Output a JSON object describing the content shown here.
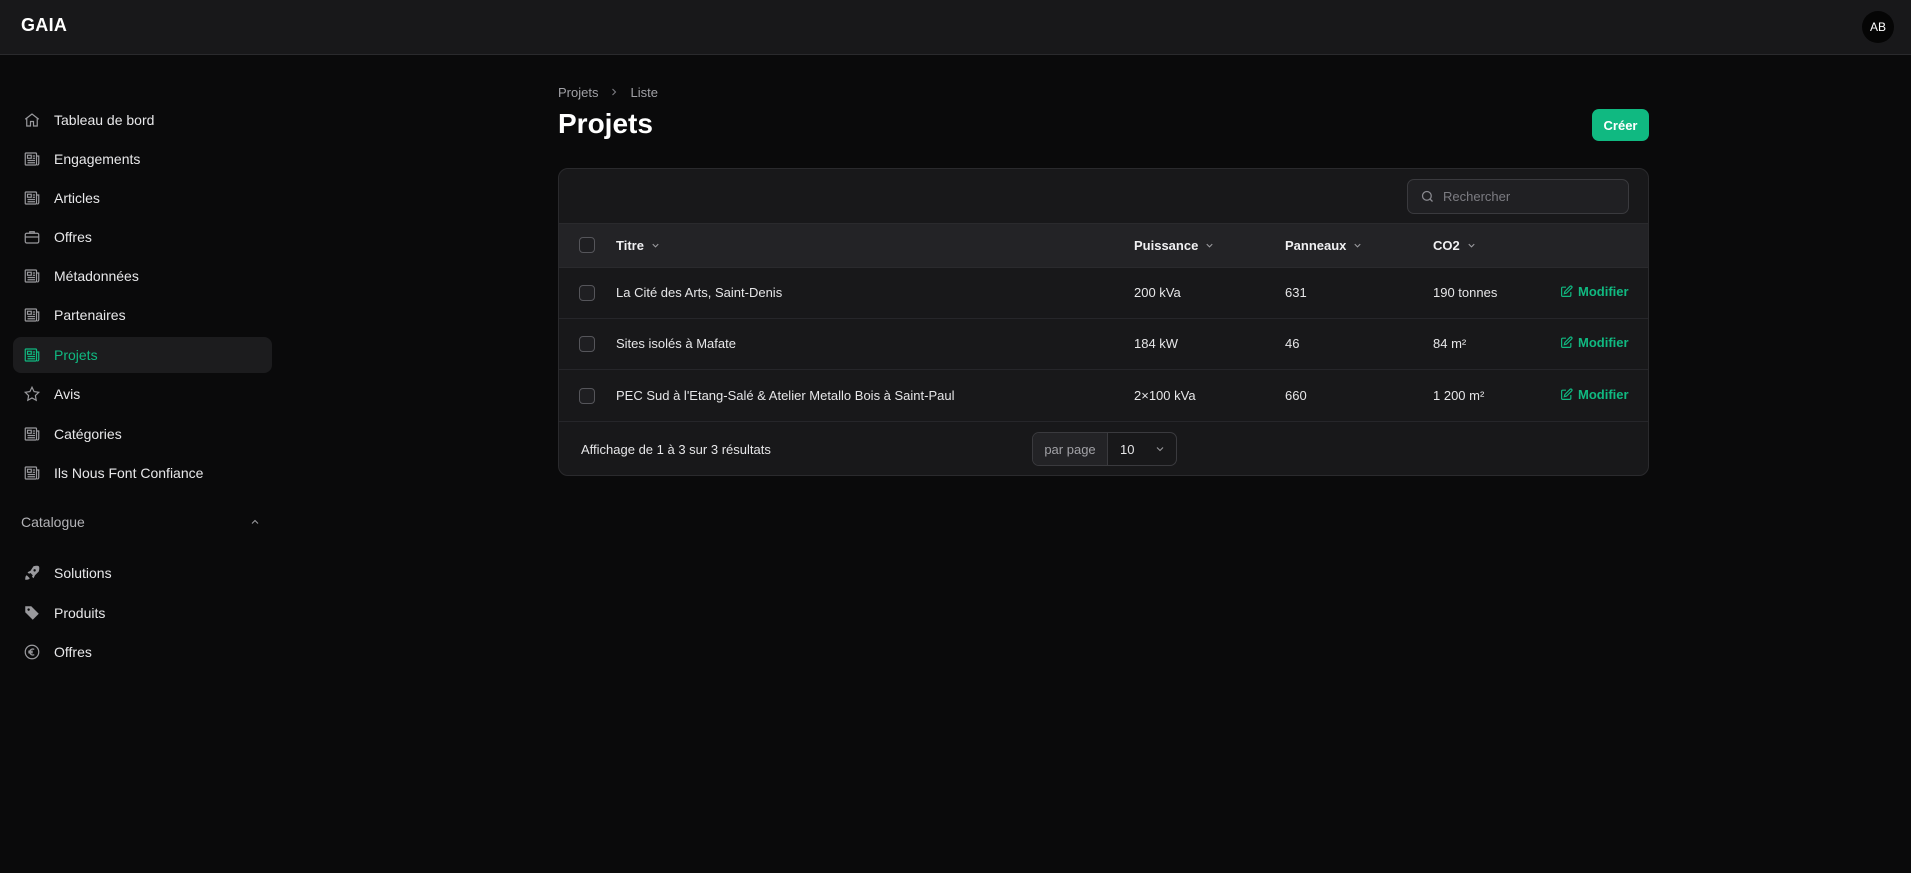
{
  "app": {
    "brand": "GAIA",
    "avatar_initials": "AB"
  },
  "sidebar": {
    "items": [
      {
        "label": "Tableau de bord",
        "icon": "home-icon",
        "active": false
      },
      {
        "label": "Engagements",
        "icon": "newspaper-icon",
        "active": false
      },
      {
        "label": "Articles",
        "icon": "newspaper-icon",
        "active": false
      },
      {
        "label": "Offres",
        "icon": "briefcase-icon",
        "active": false
      },
      {
        "label": "Métadonnées",
        "icon": "newspaper-icon",
        "active": false
      },
      {
        "label": "Partenaires",
        "icon": "newspaper-icon",
        "active": false
      },
      {
        "label": "Projets",
        "icon": "newspaper-icon",
        "active": true
      },
      {
        "label": "Avis",
        "icon": "star-icon",
        "active": false
      },
      {
        "label": "Catégories",
        "icon": "newspaper-icon",
        "active": false
      },
      {
        "label": "Ils Nous Font Confiance",
        "icon": "newspaper-icon",
        "active": false
      }
    ],
    "group": {
      "label": "Catalogue",
      "items": [
        {
          "label": "Solutions",
          "icon": "rocket-icon"
        },
        {
          "label": "Produits",
          "icon": "tag-icon"
        },
        {
          "label": "Offres",
          "icon": "euro-icon"
        }
      ]
    }
  },
  "breadcrumb": {
    "parent": "Projets",
    "current": "Liste"
  },
  "page": {
    "title": "Projets",
    "create_label": "Créer"
  },
  "table": {
    "search_placeholder": "Rechercher",
    "columns": [
      "Titre",
      "Puissance",
      "Panneaux",
      "CO2"
    ],
    "rows": [
      {
        "titre": "La Cité des Arts, Saint-Denis",
        "puissance": "200 kVa",
        "panneaux": "631",
        "co2": "190 tonnes"
      },
      {
        "titre": "Sites isolés à Mafate",
        "puissance": "184 kW",
        "panneaux": "46",
        "co2": "84 m²"
      },
      {
        "titre": "PEC Sud à l'Etang-Salé & Atelier Metallo Bois à Saint-Paul",
        "puissance": "2×100 kVa",
        "panneaux": "660",
        "co2": "1 200 m²"
      }
    ],
    "edit_label": "Modifier",
    "footer_text": "Affichage de 1 à 3 sur 3 résultats",
    "per_page_label": "par page",
    "per_page_value": "10"
  },
  "colors": {
    "accent": "#10b981",
    "background": "#0a0a0b",
    "surface": "#18181a"
  }
}
